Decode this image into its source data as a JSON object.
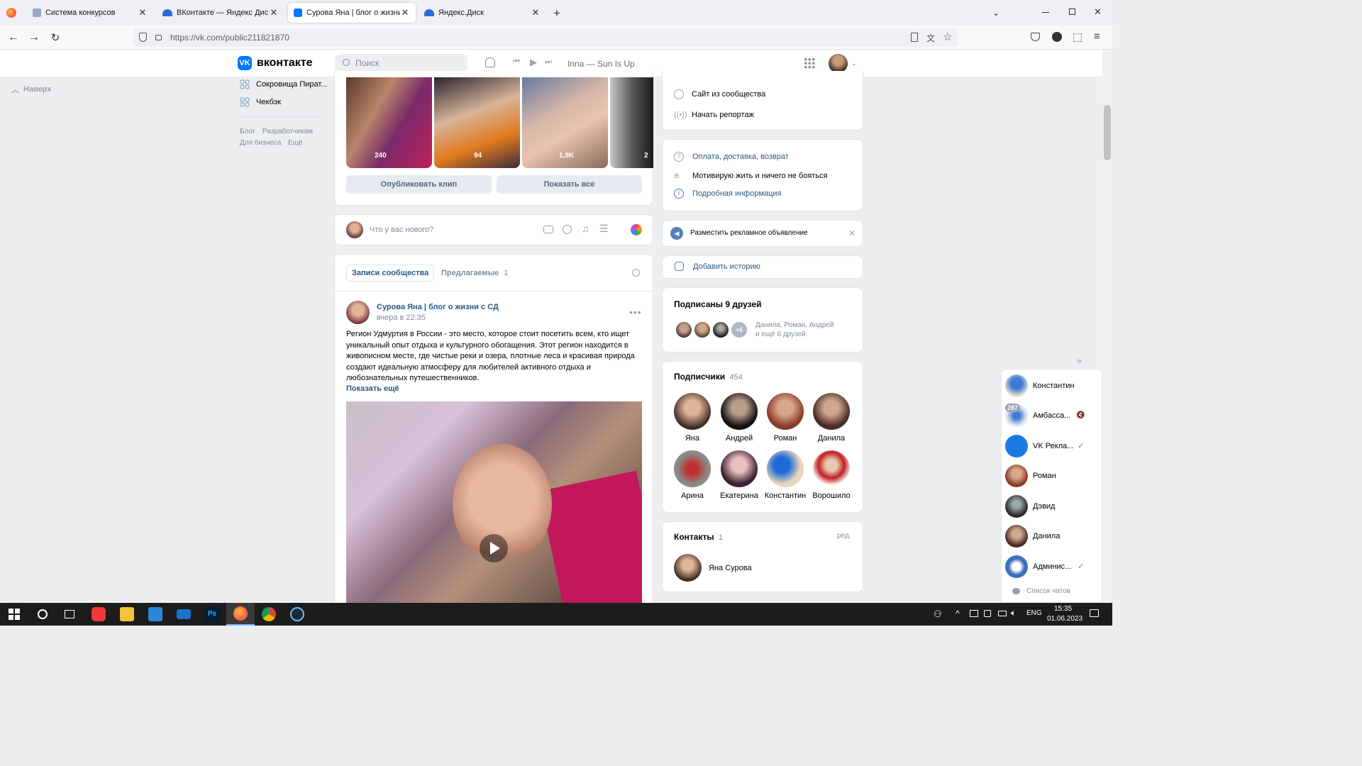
{
  "browser": {
    "tabs": [
      {
        "title": "Система конкурсов"
      },
      {
        "title": "ВКонтакте — Яндекс Диск"
      },
      {
        "title": "Сурова Яна | блог о жизни с С"
      },
      {
        "title": "Яндекс.Диск"
      }
    ],
    "url": "https://vk.com/public211821870"
  },
  "vk": {
    "logo_text": "вконтакте",
    "search_placeholder": "Поиск",
    "now_playing": "Inna — Sun Is Up",
    "accent": "#0077ff"
  },
  "left": {
    "back_to_top": "Наверх",
    "menu": [
      "Сокровища Пират...",
      "Чекбэк"
    ],
    "footer": [
      "Блог",
      "Разработчикам",
      "Для бизнеса",
      "Ещё"
    ]
  },
  "clips": {
    "views": [
      "240",
      "94",
      "1,9K",
      "2"
    ],
    "publish_button": "Опубликовать клип",
    "show_all_button": "Показать все"
  },
  "composer": {
    "placeholder": "Что у вас нового?"
  },
  "wall": {
    "tab_community": "Записи сообщества",
    "tab_suggested": "Предлагаемые",
    "suggested_count": "1"
  },
  "post": {
    "author": "Сурова Яна | блог о жизни с СД",
    "time": "вчера в 22:35",
    "text": "Регион Удмуртия в России - это место, которое стоит посетить всем, кто ищет уникальный опыт отдыха и культурного обогащения. Этот регион находится в живописном месте, где чистые реки и озера, плотные леса и красивая природа создают идеальную атмосферу для любителей активного отдыха и любознательных путешественников.",
    "show_more": "Показать ещё"
  },
  "right": {
    "actions": [
      "Сайт из сообщества",
      "Начать репортаж"
    ],
    "info_links": [
      "Оплата, доставка, возврат",
      "Мотивирую жить и ничего не бояться",
      "Подробная информация"
    ],
    "ad": "Разместить рекламное объявление",
    "add_story": "Добавить историю",
    "friends_title": "Подписаны 9 друзей",
    "friends_more": "+6",
    "friends_line1": "Данила, Роман, Андрей",
    "friends_line2": "и ещё 6 друзей",
    "subscribers_title": "Подписчики",
    "subscribers_count": "454",
    "subscribers": [
      "Яна",
      "Андрей",
      "Роман",
      "Данила",
      "Арина",
      "Екатерина",
      "Константин",
      "Ворошило"
    ],
    "contacts_title": "Контакты",
    "contacts_count": "1",
    "contacts_edit": "ред.",
    "contact_name": "Яна Сурова"
  },
  "chats": {
    "items": [
      {
        "name": "Константин",
        "badge": ""
      },
      {
        "name": "Амбасса...",
        "badge": "287"
      },
      {
        "name": "VK Рекла...",
        "badge": ""
      },
      {
        "name": "Роман",
        "badge": ""
      },
      {
        "name": "Дэвид",
        "badge": ""
      },
      {
        "name": "Данила",
        "badge": ""
      },
      {
        "name": "Админис...",
        "badge": ""
      }
    ],
    "list_label": "Список чатов"
  },
  "taskbar": {
    "lang": "ENG",
    "time": "15:35",
    "date": "01.06.2023"
  }
}
